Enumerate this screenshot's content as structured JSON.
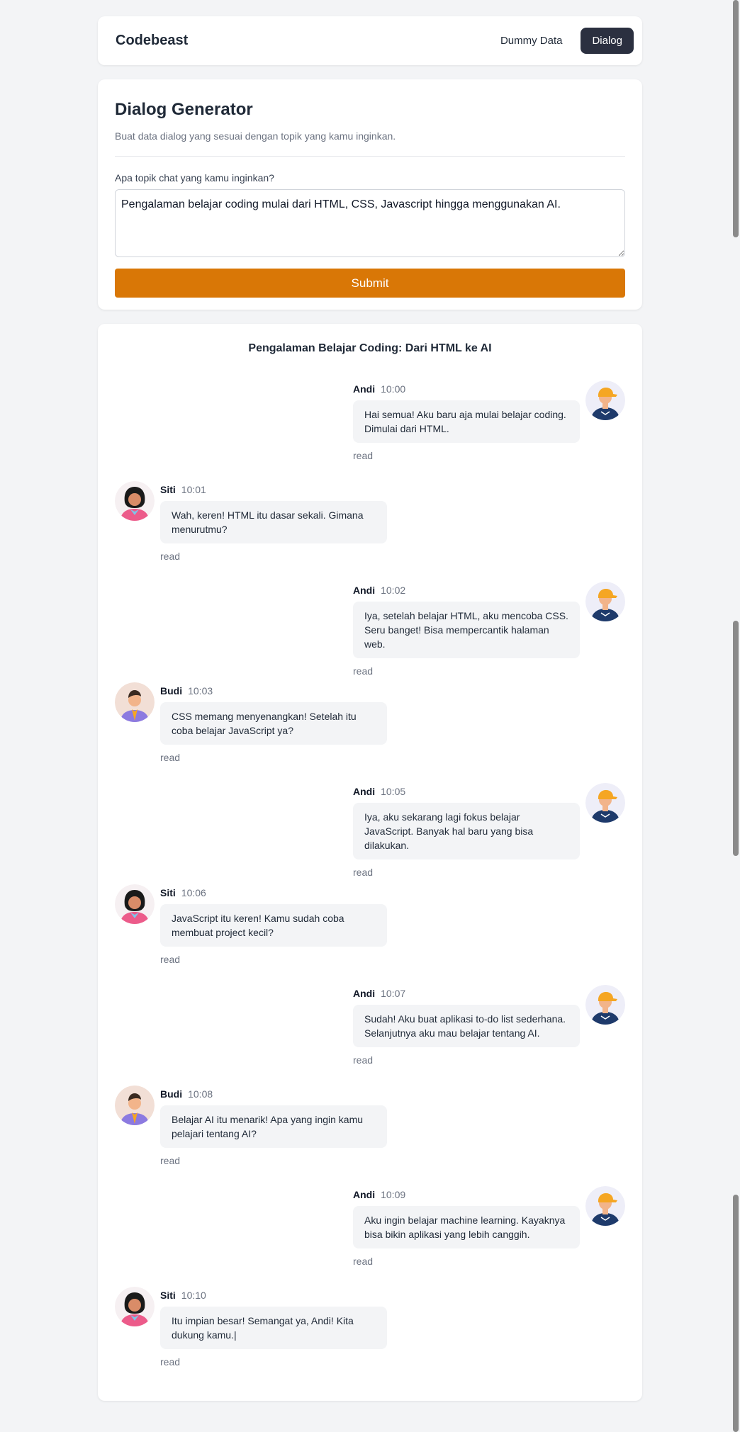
{
  "nav": {
    "brand": "Codebeast",
    "links": [
      {
        "label": "Dummy Data",
        "active": false
      },
      {
        "label": "Dialog",
        "active": true
      }
    ]
  },
  "generator": {
    "title": "Dialog Generator",
    "subtitle": "Buat data dialog yang sesuai dengan topik yang kamu inginkan.",
    "label": "Apa topik chat yang kamu inginkan?",
    "topic_value": "Pengalaman belajar coding mulai dari HTML, CSS, Javascript hingga menggunakan AI.",
    "submit_label": "Submit"
  },
  "chat": {
    "title": "Pengalaman Belajar Coding: Dari HTML ke AI",
    "messages": [
      {
        "name": "Andi",
        "time": "10:00",
        "text": "Hai semua! Aku baru aja mulai belajar coding. Dimulai dari HTML.",
        "status": "read",
        "side": "right",
        "avatar": "man-cap-avatar"
      },
      {
        "name": "Siti",
        "time": "10:01",
        "text": "Wah, keren! HTML itu dasar sekali. Gimana menurutmu?",
        "status": "read",
        "side": "left",
        "avatar": "woman-avatar"
      },
      {
        "name": "Andi",
        "time": "10:02",
        "text": "Iya, setelah belajar HTML, aku mencoba CSS. Seru banget! Bisa mempercantik halaman web.",
        "status": "read",
        "side": "right",
        "avatar": "man-cap-avatar"
      },
      {
        "name": "Budi",
        "time": "10:03",
        "text": "CSS memang menyenangkan! Setelah itu coba belajar JavaScript ya?",
        "status": "read",
        "side": "left",
        "avatar": "man-scarf-avatar"
      },
      {
        "name": "Andi",
        "time": "10:05",
        "text": "Iya, aku sekarang lagi fokus belajar JavaScript. Banyak hal baru yang bisa dilakukan.",
        "status": "read",
        "side": "right",
        "avatar": "man-cap-avatar"
      },
      {
        "name": "Siti",
        "time": "10:06",
        "text": "JavaScript itu keren! Kamu sudah coba membuat project kecil?",
        "status": "read",
        "side": "left",
        "avatar": "woman-avatar"
      },
      {
        "name": "Andi",
        "time": "10:07",
        "text": "Sudah! Aku buat aplikasi to-do list sederhana. Selanjutnya aku mau belajar tentang AI.",
        "status": "read",
        "side": "right",
        "avatar": "man-cap-avatar"
      },
      {
        "name": "Budi",
        "time": "10:08",
        "text": "Belajar AI itu menarik! Apa yang ingin kamu pelajari tentang AI?",
        "status": "read",
        "side": "left",
        "avatar": "man-scarf-avatar"
      },
      {
        "name": "Andi",
        "time": "10:09",
        "text": "Aku ingin belajar machine learning. Kayaknya bisa bikin aplikasi yang lebih canggih.",
        "status": "read",
        "side": "right",
        "avatar": "man-cap-avatar"
      },
      {
        "name": "Siti",
        "time": "10:10",
        "text": "Itu impian besar! Semangat ya, Andi! Kita dukung kamu.|",
        "status": "read",
        "side": "left",
        "avatar": "woman-avatar"
      }
    ]
  },
  "colors": {
    "accent": "#d97706",
    "nav_active": "#2b3040",
    "bubble": "#f3f4f6",
    "page_bg": "#f3f4f6"
  }
}
